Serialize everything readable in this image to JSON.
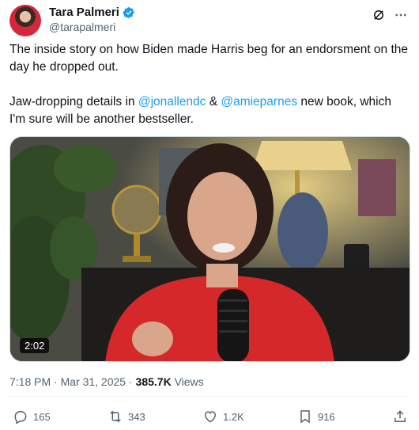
{
  "post": {
    "author_name": "Tara Palmeri",
    "author_handle": "@tarapalmeri",
    "text_line1": "The inside story on how Biden made Harris beg for an endorsment on the day he dropped out.",
    "text_line2_pre": "Jaw-dropping details in ",
    "mention1": "@jonallendc",
    "text_line2_mid": " & ",
    "mention2": "@amieparnes",
    "text_line2_post": " new book, which I'm sure will be another bestseller.",
    "video_duration": "2:02",
    "timestamp": "7:18 PM · Mar 31, 2025 · ",
    "views_count": "385.7K",
    "views_label": " Views"
  },
  "actions": {
    "replies": "165",
    "reposts": "343",
    "likes": "1.2K",
    "bookmarks": "916"
  },
  "colors": {
    "accent": "#1d9bf0",
    "muted": "#536471",
    "text": "#0f1419"
  },
  "icons": [
    "verified-badge-icon",
    "grok-icon",
    "more-icon",
    "reply-icon",
    "repost-icon",
    "like-icon",
    "bookmark-icon",
    "share-icon"
  ]
}
